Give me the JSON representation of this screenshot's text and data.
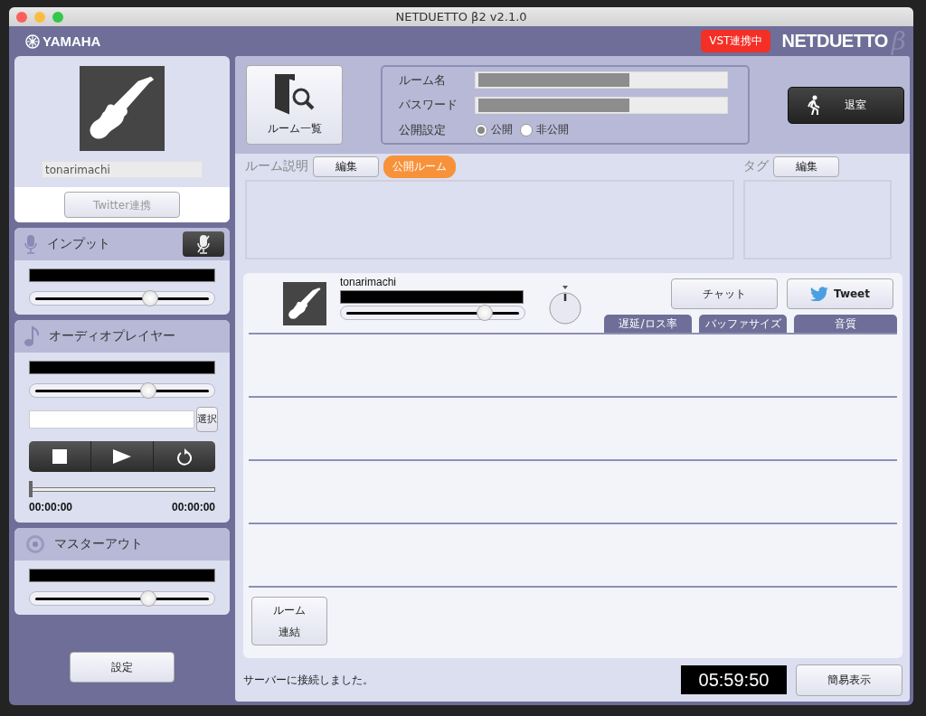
{
  "window": {
    "title": "NETDUETTO β2 v2.1.0"
  },
  "header": {
    "brand": "YAMAHA",
    "vst_badge": "VST連携中",
    "product_logo": "NETDUETTO",
    "product_suffix": "β"
  },
  "profile": {
    "name": "tonarimachi",
    "twitter_button": {
      "label": "Twitter連携",
      "disabled": true
    }
  },
  "input": {
    "title": "インプット",
    "muted": true,
    "volume": {
      "level": 0.66
    }
  },
  "audio_player": {
    "title": "オーディオプレイヤー",
    "volume": {
      "level": 0.65
    },
    "select_button": "選択",
    "seek": {
      "level": 0
    },
    "start_time": "00:00:00",
    "end_time": "00:00:00"
  },
  "master_out": {
    "title": "マスターアウト",
    "volume": {
      "level": 0.65
    }
  },
  "settings_button": "設定",
  "room": {
    "list_button": "ルーム一覧",
    "name_label": "ルーム名",
    "password_label": "パスワード",
    "visibility_label": "公開設定",
    "visibility_options": [
      {
        "label": "公開",
        "selected": true
      },
      {
        "label": "非公開",
        "selected": false
      }
    ],
    "leave_button": "退室"
  },
  "description": {
    "label": "ルーム説明",
    "edit_button": "編集",
    "badge": "公開ルーム"
  },
  "tags": {
    "label": "タグ",
    "edit_button": "編集"
  },
  "members": [
    {
      "name": "tonarimachi",
      "volume": {
        "level": 0.8
      }
    }
  ],
  "chat_button": "チャット",
  "tweet_button": "Tweet",
  "columns": [
    "遅延/ロス率",
    "バッファサイズ",
    "音質"
  ],
  "connect_button": {
    "label_lines": [
      "ルーム",
      "連結"
    ]
  },
  "status": {
    "message": "サーバーに接続しました。",
    "timer": "05:59:50",
    "compact_button": "簡易表示"
  }
}
